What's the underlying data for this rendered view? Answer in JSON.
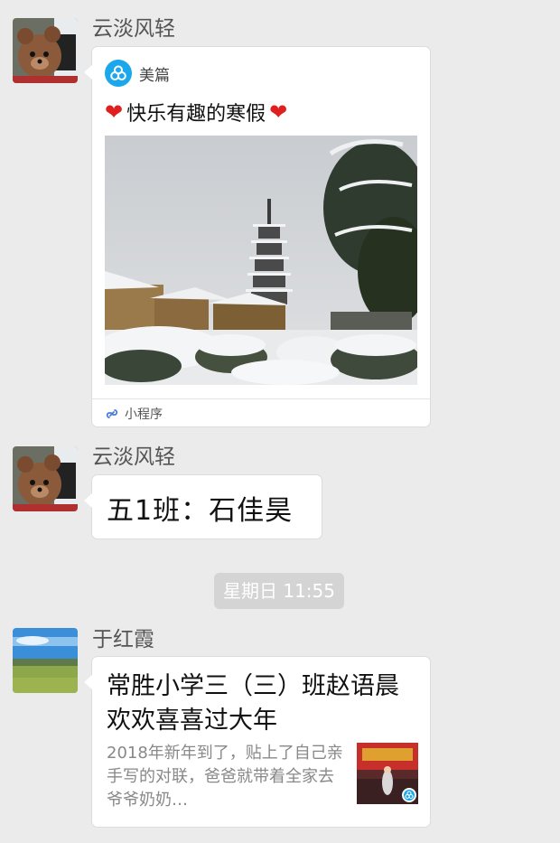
{
  "messages": [
    {
      "sender": "云淡风轻",
      "type": "mini_program",
      "app_name": "美篇",
      "app_icon": "meipian-logo-icon",
      "title": "快乐有趣的寒假",
      "title_decoration": "heart-emoji",
      "image": "snow-pagoda-photo",
      "footer_label": "小程序",
      "footer_icon": "mini-program-link-icon"
    },
    {
      "sender": "云淡风轻",
      "type": "text",
      "text": "五1班：石佳昊"
    },
    {
      "type": "timestamp",
      "text": "星期日 11:55"
    },
    {
      "sender": "于红霞",
      "type": "article",
      "title": "常胜小学三（三）班赵语晨欢欢喜喜过大年",
      "description": "2018年新年到了，贴上了自己亲手写的对联，爸爸就带着全家去爷爷奶奶…",
      "thumbnail": "new-year-stage-photo"
    }
  ],
  "colors": {
    "background": "#ebebeb",
    "bubble": "#ffffff",
    "timestamp_bg": "#d4d4d4",
    "meipian_blue": "#1aa7ec",
    "heart_red": "#e02020"
  }
}
